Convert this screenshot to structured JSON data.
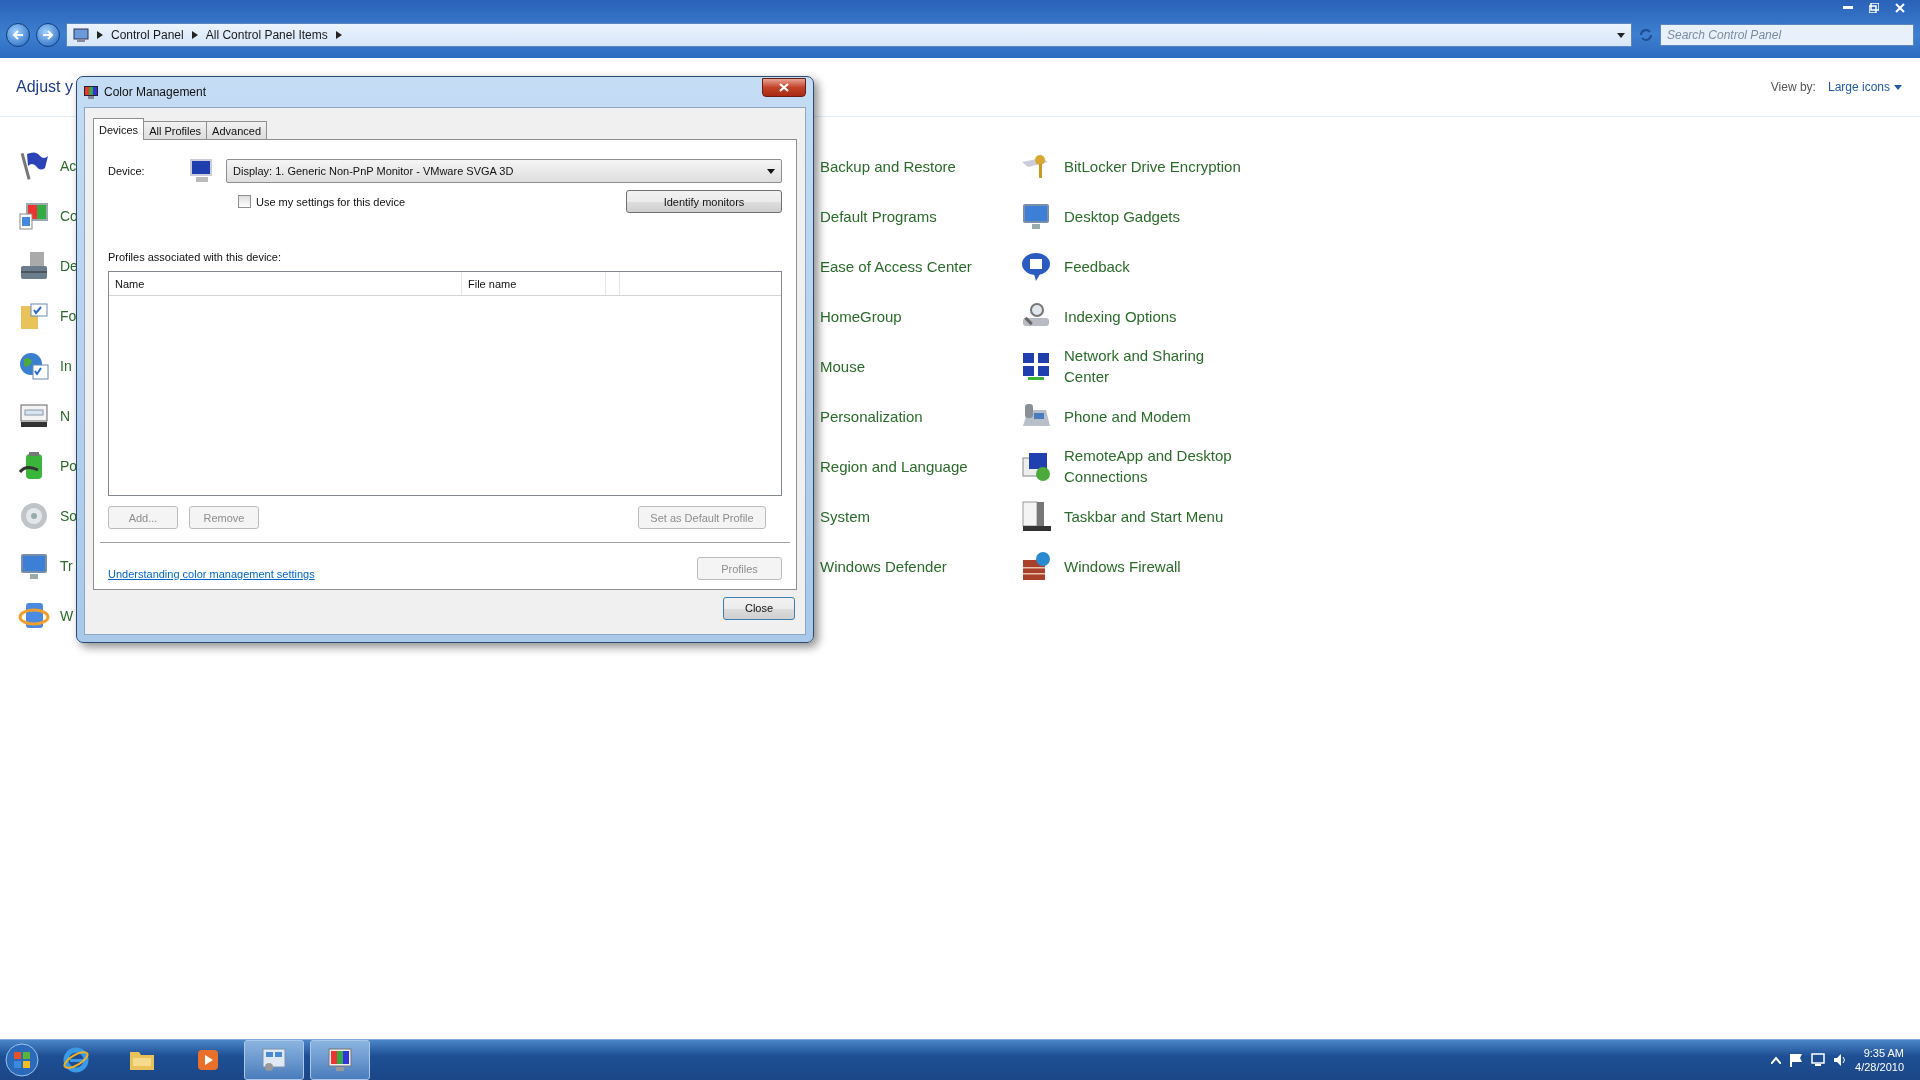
{
  "address_bar": {
    "breadcrumbs": [
      "Control Panel",
      "All Control Panel Items"
    ]
  },
  "search": {
    "placeholder": "Search Control Panel"
  },
  "header": {
    "title": "Adjust y",
    "view_by_label": "View by:",
    "view_by_value": "Large icons"
  },
  "columns": [
    [
      {
        "label": "Ac"
      },
      {
        "label": "Co"
      },
      {
        "label": "De"
      },
      {
        "label": "Fo"
      },
      {
        "label": "In"
      },
      {
        "label": "N"
      },
      {
        "label": "Po"
      },
      {
        "label": "So"
      },
      {
        "label": "Tr"
      },
      {
        "label": "W"
      }
    ],
    [
      {
        "label": "Backup and Restore"
      },
      {
        "label": "Default Programs"
      },
      {
        "label": "Ease of Access Center"
      },
      {
        "label": "HomeGroup"
      },
      {
        "label": "Mouse"
      },
      {
        "label": "Personalization"
      },
      {
        "label": "Region and Language"
      },
      {
        "label": "System"
      },
      {
        "label": "Windows Defender"
      }
    ],
    [
      {
        "label": "BitLocker Drive Encryption"
      },
      {
        "label": "Desktop Gadgets"
      },
      {
        "label": "Feedback"
      },
      {
        "label": "Indexing Options"
      },
      {
        "label": "Network and Sharing Center"
      },
      {
        "label": "Phone and Modem"
      },
      {
        "label": "RemoteApp and Desktop Connections"
      },
      {
        "label": "Taskbar and Start Menu"
      },
      {
        "label": "Windows Firewall"
      }
    ]
  ],
  "dialog": {
    "title": "Color Management",
    "tabs": [
      {
        "label": "Devices",
        "selected": true
      },
      {
        "label": "All Profiles",
        "selected": false
      },
      {
        "label": "Advanced",
        "selected": false
      }
    ],
    "device_label": "Device:",
    "device_value": "Display: 1. Generic Non-PnP Monitor - VMware SVGA 3D",
    "use_my_settings": {
      "label": "Use my settings for this device",
      "checked": false
    },
    "identify_button": "Identify monitors",
    "profiles_label": "Profiles associated with this device:",
    "profiles_table": {
      "columns": [
        "Name",
        "File name"
      ]
    },
    "buttons": [
      {
        "label": "Add...",
        "disabled": true
      },
      {
        "label": "Remove",
        "disabled": true
      },
      {
        "label": "Set as Default Profile",
        "disabled": true
      }
    ],
    "link": "Understanding color management settings",
    "profiles_button": {
      "label": "Profiles",
      "disabled": true
    },
    "close_button": "Close"
  },
  "taskbar": {
    "buttons": [
      {
        "running": false
      },
      {
        "running": false
      },
      {
        "running": false
      },
      {
        "running": true
      },
      {
        "running": true
      }
    ],
    "clock": {
      "time": "9:35 AM",
      "date": "4/28/2010"
    }
  }
}
